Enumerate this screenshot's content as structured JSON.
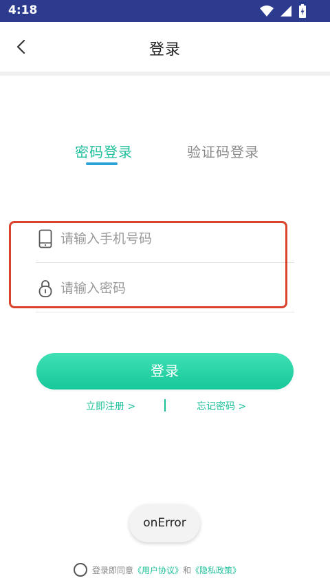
{
  "status_bar": {
    "time": "4:18",
    "icons": [
      "wifi-icon",
      "signal-icon",
      "battery-icon"
    ]
  },
  "header": {
    "title": "登录",
    "back_icon": "chevron-left-icon"
  },
  "tabs": [
    {
      "label": "密码登录",
      "active": true
    },
    {
      "label": "验证码登录",
      "active": false
    }
  ],
  "form": {
    "phone": {
      "placeholder": "请输入手机号码",
      "value": "",
      "icon": "phone-icon"
    },
    "password": {
      "placeholder": "请输入密码",
      "value": "",
      "icon": "lock-icon"
    }
  },
  "login_button": {
    "label": "登录"
  },
  "links": {
    "register": "立即注册 >",
    "forgot": "忘记密码 >"
  },
  "toast": {
    "text": "onError"
  },
  "agreement": {
    "prefix": "登录即同意",
    "user_agreement": "《用户协议》",
    "and": "和",
    "privacy_policy": "《隐私政策》",
    "checked": false
  },
  "colors": {
    "status_bar": "#2d3b8e",
    "accent_green": "#1dbf9a",
    "tab_indicator": "#2aa3d8",
    "highlight_border": "#d9432b"
  }
}
